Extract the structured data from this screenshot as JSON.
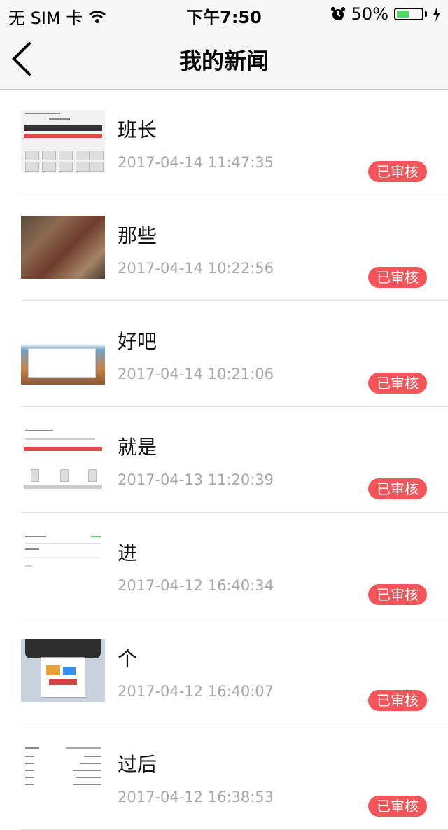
{
  "status_bar": {
    "carrier": "无 SIM 卡",
    "time": "下午7:50",
    "battery_percent": "50%",
    "battery_level": 0.5,
    "battery_color": "#4cd964"
  },
  "nav": {
    "back_icon": "chevron-left-icon",
    "title": "我的新闻"
  },
  "badge_color": "#f2555a",
  "news": [
    {
      "title": "班长",
      "time": "2017-04-14 11:47:35",
      "status": "已审核",
      "thumb": "ui-screenshot"
    },
    {
      "title": "那些",
      "time": "2017-04-14 10:22:56",
      "status": "已审核",
      "thumb": "food-photo"
    },
    {
      "title": "好吧",
      "time": "2017-04-14 10:21:06",
      "status": "已审核",
      "thumb": "web-screenshot"
    },
    {
      "title": "就是",
      "time": "2017-04-13 11:20:39",
      "status": "已审核",
      "thumb": "ui-screenshot"
    },
    {
      "title": "进",
      "time": "2017-04-12 16:40:34",
      "status": "已审核",
      "thumb": "blank-screenshot"
    },
    {
      "title": "个",
      "time": "2017-04-12 16:40:07",
      "status": "已审核",
      "thumb": "printer-photo"
    },
    {
      "title": "过后",
      "time": "2017-04-12 16:38:53",
      "status": "已审核",
      "thumb": "list-screenshot"
    }
  ]
}
